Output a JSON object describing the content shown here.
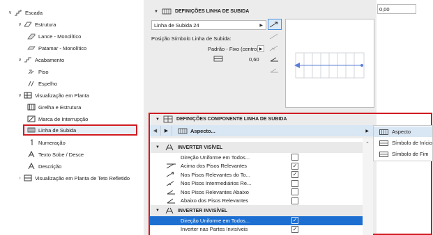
{
  "tree": {
    "items": [
      {
        "chev": "∨",
        "icon": "stair-icon",
        "label": "Escada"
      },
      {
        "chev": "∨",
        "icon": "structure-icon",
        "label": "Estrutura"
      },
      {
        "chev": "",
        "icon": "flight-icon",
        "label": "Lance - Monolítico"
      },
      {
        "chev": "",
        "icon": "landing-icon",
        "label": "Patamar - Monolítico"
      },
      {
        "chev": "∨",
        "icon": "finish-icon",
        "label": "Acabamento"
      },
      {
        "chev": "",
        "icon": "tread-icon",
        "label": "Piso"
      },
      {
        "chev": "",
        "icon": "riser-icon",
        "label": "Espelho"
      },
      {
        "chev": "∨",
        "icon": "floorplan-icon",
        "label": "Visualização em Planta"
      },
      {
        "chev": "",
        "icon": "grid-icon",
        "label": "Grelha e Estrutura"
      },
      {
        "chev": "",
        "icon": "break-mark-icon",
        "label": "Marca de Interrupção"
      },
      {
        "chev": "",
        "icon": "walking-line-icon",
        "label": "Linha de Subida"
      },
      {
        "chev": "",
        "icon": "numbering-icon",
        "label": "Numeração"
      },
      {
        "chev": "",
        "icon": "text-icon",
        "label": "Texto Sobe / Desce"
      },
      {
        "chev": "",
        "icon": "text-icon",
        "label": "Descrição"
      },
      {
        "chev": "›",
        "icon": "rcp-icon",
        "label": "Visualização em Planta de Teto Refletido"
      }
    ]
  },
  "settings": {
    "header": "DEFINIÇÕES LINHA DE SUBIDA",
    "selector_value": "Linha de Subida 24",
    "position_label": "Posição Símbolo Linha de Subida:",
    "position_value": "Padrão - Fixo (centro)",
    "distance_value": "0,60"
  },
  "right_field": {
    "value": "0,00"
  },
  "component": {
    "header": "DEFINIÇÕES COMPONENTE LINHA DE SUBIDA",
    "aspect_label": "Aspecto...",
    "groups": [
      {
        "label": "INVERTER VISÍVEL",
        "rows": [
          {
            "label": "Direção Uniforme em Todos...",
            "checked": false
          },
          {
            "label": "Acima dos Pisos Relevantes",
            "checked": true
          },
          {
            "label": "Nos Pisos Relevantes do To...",
            "checked": true
          },
          {
            "label": "Nos Pisos Intermediários Re...",
            "checked": false
          },
          {
            "label": "Nos Pisos Relevantes Abaixo",
            "checked": false
          },
          {
            "label": "Abaixo dos Pisos Relevantes",
            "checked": false
          }
        ]
      },
      {
        "label": "INVERTER INVISÍVEL",
        "rows": [
          {
            "label": "Direção Uniforme em Todos...",
            "checked": true
          },
          {
            "label": "Inverter nas Partes Invisíveis",
            "checked": true
          }
        ]
      }
    ]
  },
  "menu": {
    "items": [
      {
        "label": "Aspecto",
        "active": true
      },
      {
        "label": "Símbolo de Início",
        "active": false
      },
      {
        "label": "Símbolo de Fim",
        "active": false
      }
    ]
  },
  "colors": {
    "accent": "#1c6fd1",
    "highlight_border": "#d11a20"
  }
}
